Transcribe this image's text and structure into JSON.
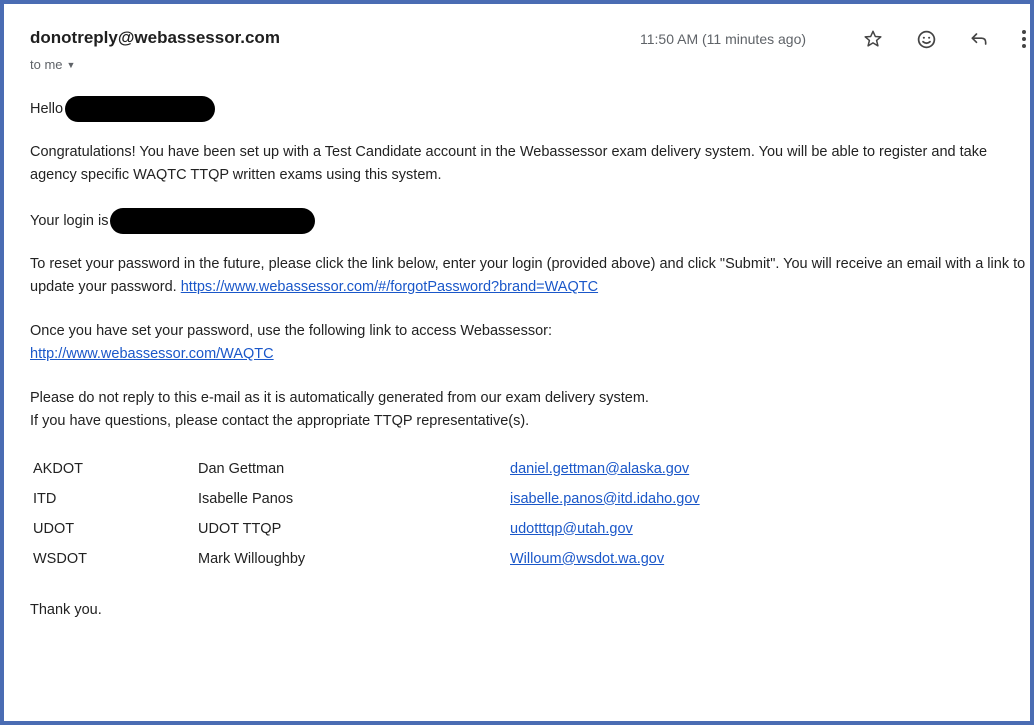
{
  "email": {
    "sender": "donotreply@webassessor.com",
    "recipient_label": "to me",
    "timestamp": "11:50 AM (11 minutes ago)"
  },
  "body": {
    "greeting": "Hello",
    "congrats": "Congratulations! You have been set up with a Test Candidate account in the Webassessor exam delivery system. You will be able to register and take agency specific WAQTC TTQP written exams using this system.",
    "login_label": "Your login is",
    "reset_text": "To reset your password in the future, please click the link below, enter your login (provided above) and click \"Submit\". You will receive an email with a link to update your password.",
    "reset_link": "https://www.webassessor.com/#/forgotPassword?brand=WAQTC",
    "access_text": "Once you have set your password, use the following link to access Webassessor:",
    "access_link": "http://www.webassessor.com/WAQTC",
    "noreply_line1": "Please do not reply to this e-mail as it is automatically generated from our exam delivery system.",
    "noreply_line2": "If you have questions, please contact the appropriate TTQP representative(s).",
    "contacts": [
      {
        "agency": "AKDOT",
        "name": "Dan Gettman",
        "email": "daniel.gettman@alaska.gov"
      },
      {
        "agency": "ITD",
        "name": "Isabelle Panos",
        "email": "isabelle.panos@itd.idaho.gov"
      },
      {
        "agency": "UDOT",
        "name": "UDOT TTQP",
        "email": "udotttqp@utah.gov"
      },
      {
        "agency": "WSDOT",
        "name": "Mark Willoughby",
        "email": "Willoum@wsdot.wa.gov"
      }
    ],
    "closing": "Thank you."
  },
  "icons": {
    "star": "star-icon",
    "emoji": "emoji-icon",
    "reply": "reply-icon",
    "more": "more-vert-icon",
    "caret": "caret-down-icon"
  },
  "colors": {
    "frame_border": "#4a6cb3",
    "link": "#1a57c9",
    "redaction": "#000000"
  }
}
